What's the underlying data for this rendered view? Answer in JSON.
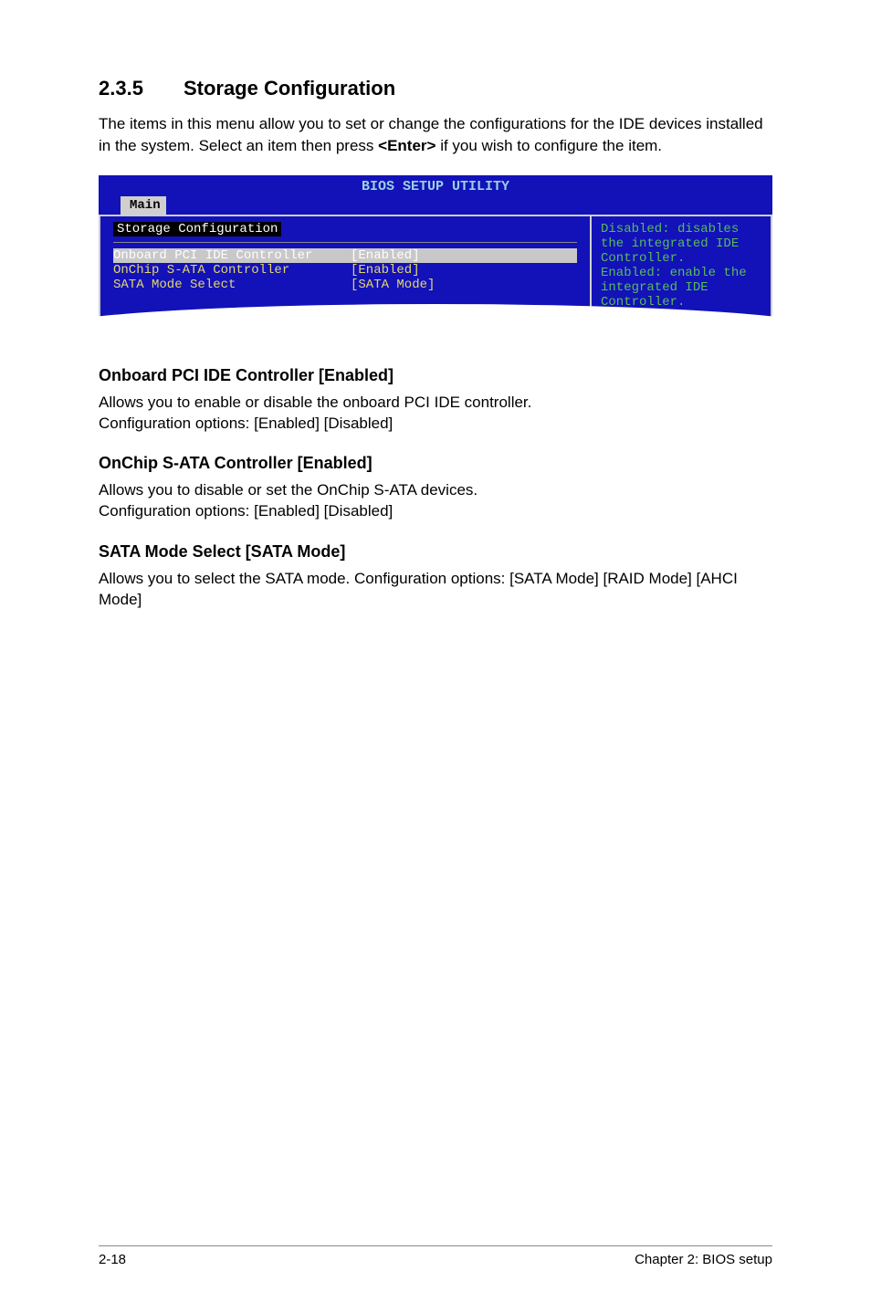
{
  "section": {
    "number": "2.3.5",
    "title": "Storage Configuration",
    "intro_pre": "The items in this menu allow you to set or change the configurations for the IDE devices installed in the system. Select an item then press ",
    "intro_bold": "<Enter>",
    "intro_post": " if you wish to configure the item."
  },
  "bios": {
    "utility_title": "BIOS SETUP UTILITY",
    "tab": "Main",
    "config_title": "Storage Configuration",
    "rows": [
      {
        "label": "Onboard PCI IDE Controller",
        "value": "[Enabled]"
      },
      {
        "label": "OnChip S-ATA Controller",
        "value": "[Enabled]"
      },
      {
        "label": "SATA Mode Select",
        "value": "[SATA Mode]"
      }
    ],
    "help_text": "Disabled: disables the integrated IDE Controller.\nEnabled: enable the integrated IDE Controller."
  },
  "subsections": [
    {
      "heading": "Onboard PCI IDE Controller [Enabled]",
      "body": "Allows you to enable or disable the onboard PCI IDE controller.\nConfiguration options: [Enabled] [Disabled]"
    },
    {
      "heading": "OnChip S-ATA Controller [Enabled]",
      "body": "Allows you to disable or set the OnChip S-ATA devices.\nConfiguration options: [Enabled] [Disabled]"
    },
    {
      "heading": "SATA Mode Select [SATA Mode]",
      "body": "Allows you to select the SATA mode. Configuration options: [SATA Mode] [RAID Mode] [AHCI Mode]"
    }
  ],
  "footer": {
    "page": "2-18",
    "chapter": "Chapter 2: BIOS setup"
  }
}
